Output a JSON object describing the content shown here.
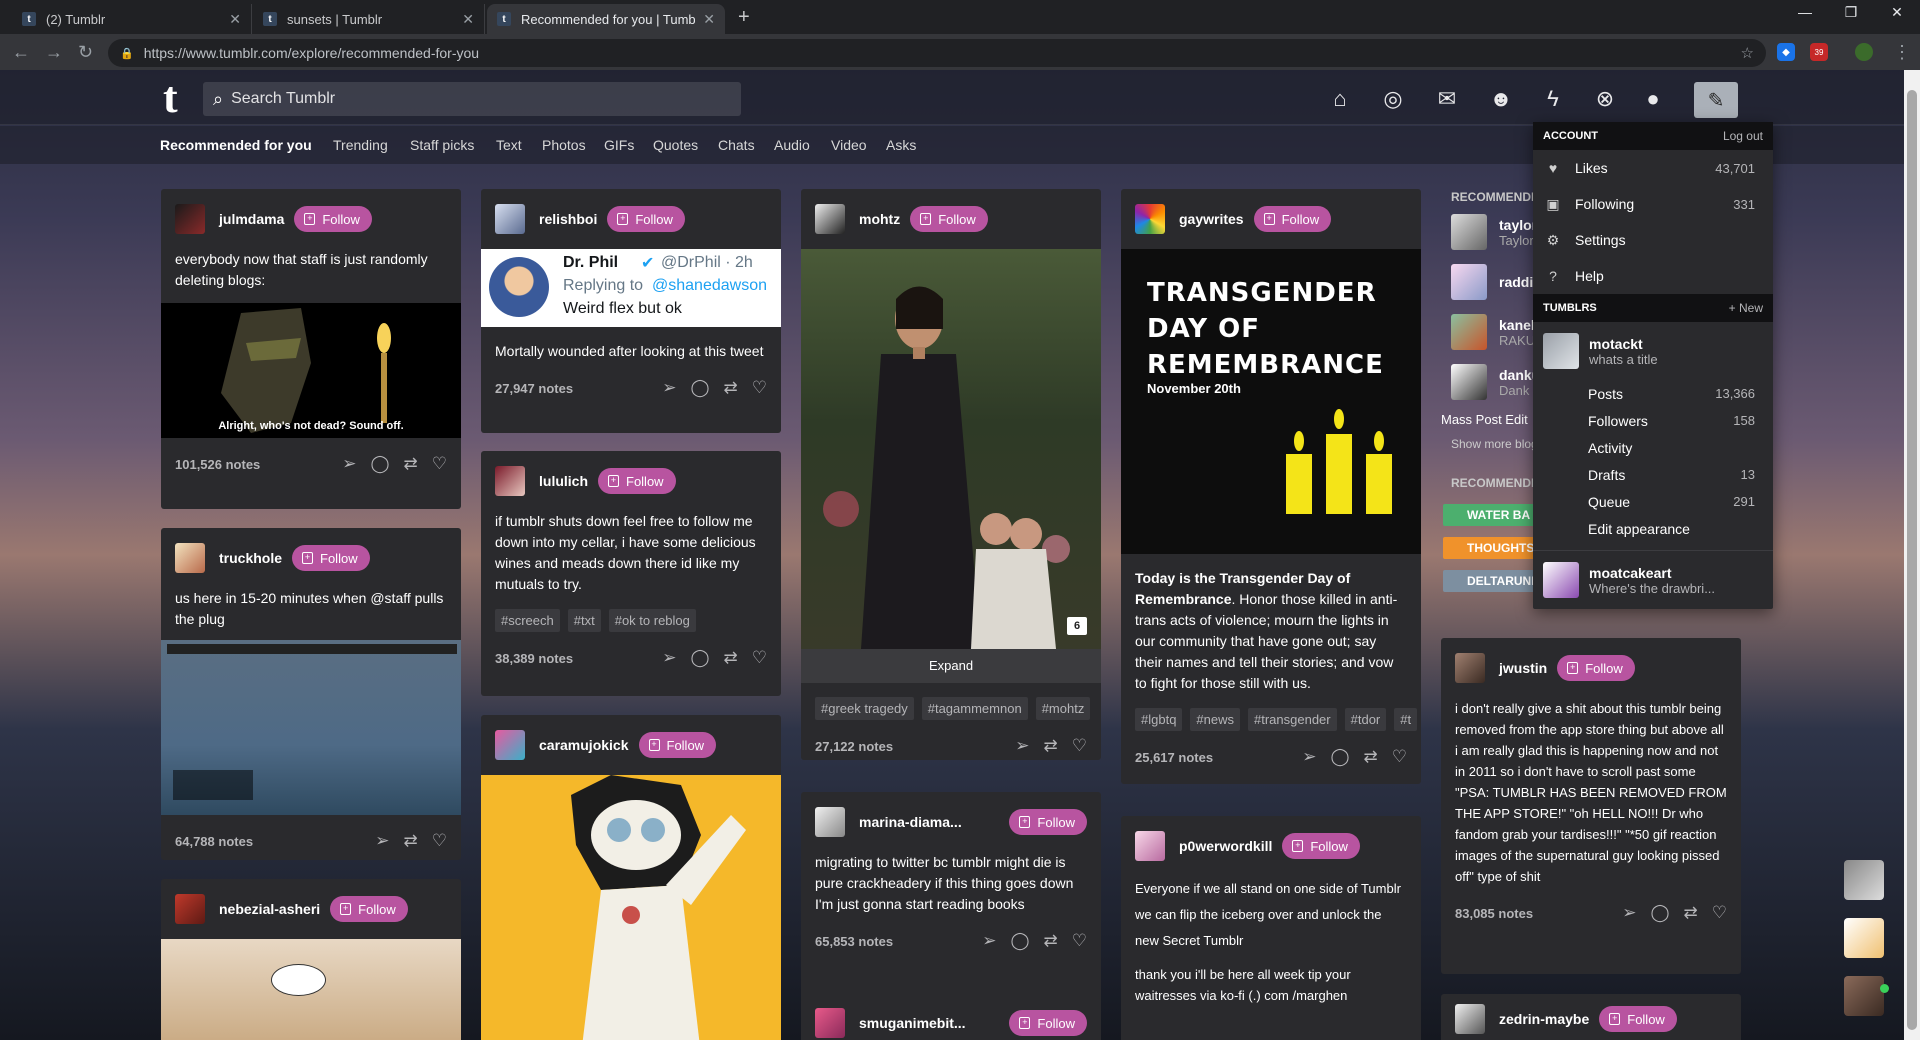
{
  "browser": {
    "tabs": [
      {
        "label": "(2) Tumblr",
        "favicon": "t"
      },
      {
        "label": "sunsets | Tumblr",
        "favicon": "t"
      },
      {
        "label": "Recommended for you | Tumblr",
        "favicon": "t"
      }
    ],
    "new_tab": "+",
    "url": "https://www.tumblr.com/explore/recommended-for-you",
    "ext_badge": "39"
  },
  "header": {
    "logo": "t",
    "search_placeholder": "Search Tumblr"
  },
  "subnav": [
    "Recommended for you",
    "Trending",
    "Staff picks",
    "Text",
    "Photos",
    "GIFs",
    "Quotes",
    "Chats",
    "Audio",
    "Video",
    "Asks"
  ],
  "follow_label": "Follow",
  "posts": {
    "julmdama": {
      "user": "julmdama",
      "text": "everybody now that staff is just randomly deleting blogs:",
      "caption": "Alright, who's not dead? Sound off.",
      "notes": "101,526 notes"
    },
    "truckhole": {
      "user": "truckhole",
      "text": "us here in 15-20 minutes when @staff pulls the plug",
      "notes": "64,788 notes"
    },
    "nebezial": {
      "user": "nebezial-asheri"
    },
    "relishboi": {
      "user": "relishboi",
      "tweet_name": "Dr. Phil",
      "tweet_handle": "@DrPhil · 2h",
      "tweet_reply": "Replying to",
      "tweet_reply_to": "@shanedawson",
      "tweet_text": "Weird flex but ok",
      "text": "Mortally wounded after looking at this tweet",
      "notes": "27,947 notes"
    },
    "lululich": {
      "user": "lululich",
      "text": "if tumblr shuts down feel free to follow me down into my cellar, i have some delicious wines and meads down there id like my mutuals to try.",
      "tags": [
        "#screech",
        "#txt",
        "#ok to reblog"
      ],
      "notes": "38,389 notes"
    },
    "caramujokick": {
      "user": "caramujokick"
    },
    "mohtz": {
      "user": "mohtz",
      "badge": "6",
      "expand": "Expand",
      "tags": [
        "#greek tragedy",
        "#tagammemnon",
        "#mohtz"
      ],
      "notes": "27,122 notes"
    },
    "marina": {
      "user": "marina-diama...",
      "text": "migrating to twitter bc tumblr might die is pure crackheadery if this thing goes down I'm just gonna start reading books",
      "notes": "65,853 notes"
    },
    "smuganimebit": {
      "user": "smuganimebit..."
    },
    "gaywrites": {
      "user": "gaywrites",
      "poster_line1": "TRANSGENDER",
      "poster_line2": "DAY OF",
      "poster_line3": "REMEMBRANCE",
      "poster_date": "November 20th",
      "text_bold": "Today is the Transgender Day of Remembrance",
      "text_rest": ". Honor those killed in anti-trans acts of violence; mourn the lights in our community that have gone out; say their names and tell their stories; and vow to fight for those still with us.",
      "tags": [
        "#lgbtq",
        "#news",
        "#transgender",
        "#tdor",
        "#t"
      ],
      "notes": "25,617 notes"
    },
    "p0werwordkill": {
      "user": "p0werwordkill",
      "text1": "Everyone if we all stand on one side of Tumblr we can flip the iceberg over and unlock the new Secret Tumblr",
      "text2": "thank you i'll be here all week tip your waitresses via ko-fi (.) com /marghen"
    },
    "jwustin": {
      "user": "jwustin",
      "text": "i don't really give a shit about this tumblr being removed from the app store thing but above all i am really glad this is happening now and not in 2011 so i don't have to scroll past some \"PSA: TUMBLR HAS BEEN REMOVED FROM THE APP STORE!\" \"oh HELL NO!!! Dr who fandom grab your tardises!!!\" \"*50 gif reaction images of the supernatural guy looking pissed off\" type of shit",
      "notes": "83,085 notes"
    },
    "zedrin": {
      "user": "zedrin-maybe"
    }
  },
  "sidebar": {
    "heading1": "RECOMMENDED BLOGS",
    "blogs": [
      {
        "name": "taylor",
        "sub": "Taylor"
      },
      {
        "name": "raddi",
        "sub": ""
      },
      {
        "name": "kanel",
        "sub": "RAKU"
      },
      {
        "name": "danku",
        "sub": "Dank"
      }
    ],
    "mass_post": "Mass Post Edit",
    "show_more": "Show more blog",
    "heading2": "RECOMMENDED TAGS",
    "tags": [
      {
        "label": "WATER BA",
        "color": "#4caf6e"
      },
      {
        "label": "THOUGHTS",
        "color": "#f0922b"
      },
      {
        "label": "DELTARUNE",
        "color": "#7d8fa0"
      }
    ]
  },
  "account": {
    "heading": "ACCOUNT",
    "logout": "Log out",
    "items": [
      {
        "label": "Likes",
        "count": "43,701",
        "icon": "heart-icon"
      },
      {
        "label": "Following",
        "count": "331",
        "icon": "following-icon"
      },
      {
        "label": "Settings",
        "count": "",
        "icon": "gear-icon"
      },
      {
        "label": "Help",
        "count": "",
        "icon": "help-icon"
      }
    ],
    "tumblrs_heading": "TUMBLRS",
    "new": "+ New",
    "blog1": {
      "name": "motackt",
      "title": "whats a title"
    },
    "blog1_items": [
      {
        "label": "Posts",
        "count": "13,366"
      },
      {
        "label": "Followers",
        "count": "158"
      },
      {
        "label": "Activity",
        "count": ""
      },
      {
        "label": "Drafts",
        "count": "13"
      },
      {
        "label": "Queue",
        "count": "291"
      },
      {
        "label": "Edit appearance",
        "count": ""
      }
    ],
    "blog2": {
      "name": "moatcakeart",
      "title": "Where's the drawbri..."
    }
  }
}
